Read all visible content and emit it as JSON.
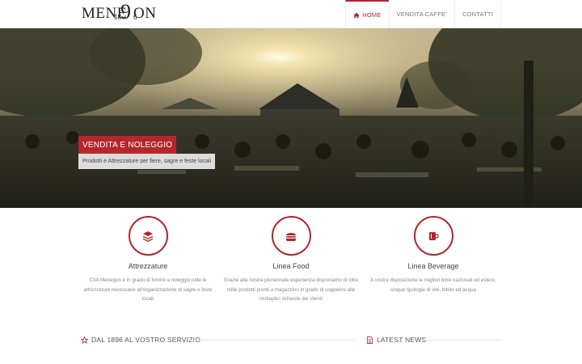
{
  "logo": {
    "word_left": "MENE",
    "word_right": "ON",
    "big_digit": "9",
    "year_a": "18",
    "year_b": "6"
  },
  "nav": {
    "items": [
      {
        "label": "HOME",
        "icon": "home-icon",
        "active": true
      },
      {
        "label": "VENDITA CAFFE'",
        "active": false
      },
      {
        "label": "CONTATTI",
        "active": false
      }
    ]
  },
  "hero": {
    "title": "VENDITA E NOLEGGIO",
    "subtitle": "Prodotti e Attrezzature per fiere, sagre e feste locali"
  },
  "features": [
    {
      "icon": "stack-icon",
      "title": "Attrezzature",
      "text": "CVA Menegon è in grado di fornire a noleggio tutte le attrezzature necessarie all'organizzazione di sagre o feste locali"
    },
    {
      "icon": "burger-icon",
      "title": "Linea Food",
      "text": "Grazie alla nostra pluriennale esperienza disponiamo di oltre mille prodotti pronti a magazzino in grado di sopperire alle molteplici richieste dei clienti"
    },
    {
      "icon": "mug-icon",
      "title": "Linea Beverage",
      "text": "A vostra disposizione le migliori birre nazionali ed estere, cinque tipologie di vini, bibite ed acqua"
    }
  ],
  "sections": {
    "left_title": "DAL 1896 AL VOSTRO SERVIZIO",
    "right_title": "LATEST NEWS"
  },
  "colors": {
    "accent": "#b0262e"
  }
}
